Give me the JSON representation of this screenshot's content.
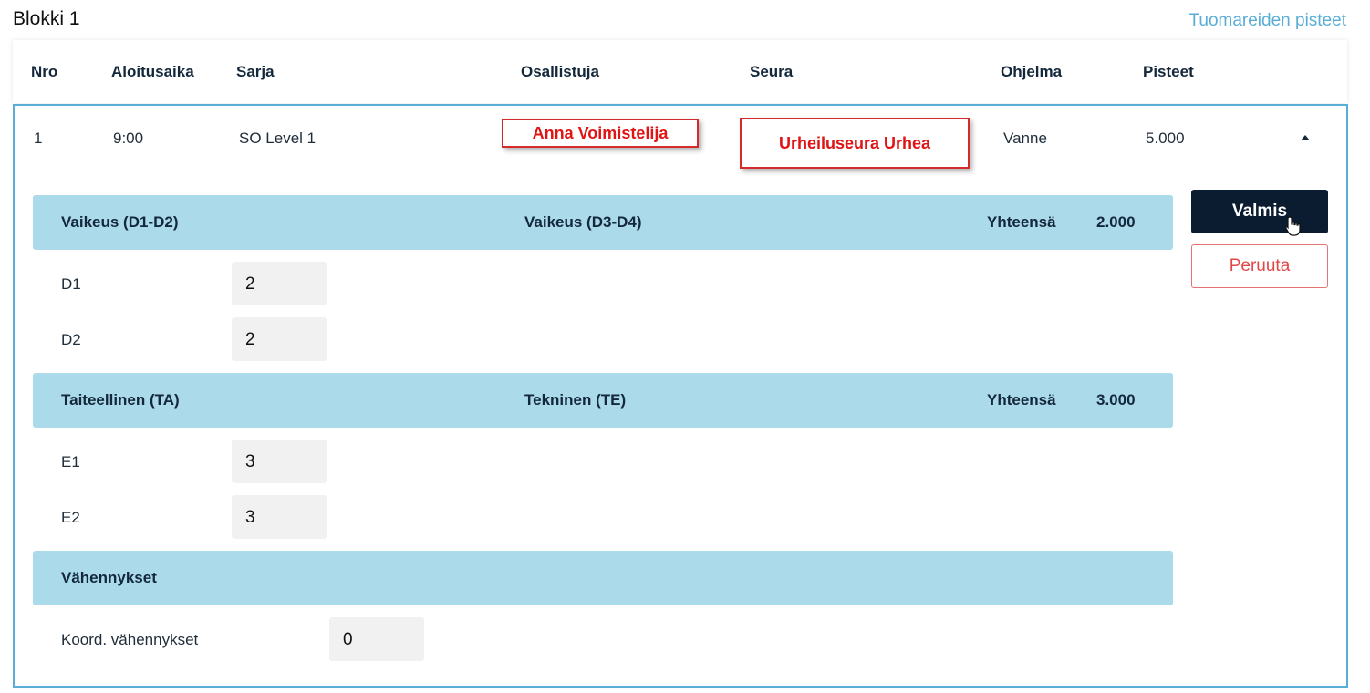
{
  "block": {
    "title": "Blokki 1",
    "judges_link": "Tuomareiden pisteet"
  },
  "table": {
    "headers": {
      "nro": "Nro",
      "start": "Aloitusaika",
      "series": "Sarja",
      "participant": "Osallistuja",
      "club": "Seura",
      "program": "Ohjelma",
      "score": "Pisteet"
    },
    "row": {
      "nro": "1",
      "start": "9:00",
      "series": "SO Level 1",
      "participant": "Anna Voimistelija",
      "club": "Urheiluseura Urhea",
      "program": "Vanne",
      "score": "5.000"
    }
  },
  "sections": {
    "difficulty": {
      "left": "Vaikeus (D1-D2)",
      "middle": "Vaikeus (D3-D4)",
      "total_label": "Yhteensä",
      "total_value": "2.000",
      "fields": [
        {
          "label": "D1",
          "value": "2"
        },
        {
          "label": "D2",
          "value": "2"
        }
      ]
    },
    "execution": {
      "left": "Taiteellinen (TA)",
      "middle": "Tekninen (TE)",
      "total_label": "Yhteensä",
      "total_value": "3.000",
      "fields": [
        {
          "label": "E1",
          "value": "3"
        },
        {
          "label": "E2",
          "value": "3"
        }
      ]
    },
    "deductions": {
      "title": "Vähennykset",
      "fields": [
        {
          "label": "Koord. vähennykset",
          "value": "0"
        }
      ]
    }
  },
  "actions": {
    "done": "Valmis",
    "cancel": "Peruuta"
  },
  "colors": {
    "accent": "#5aaed6",
    "section_bg": "#abdaeb",
    "primary_button": "#0b1b30",
    "cancel_text": "#e04848",
    "callout_red": "#e01414"
  },
  "icons": {
    "collapse": "caret-up-icon",
    "pointer": "hand-cursor-icon"
  }
}
